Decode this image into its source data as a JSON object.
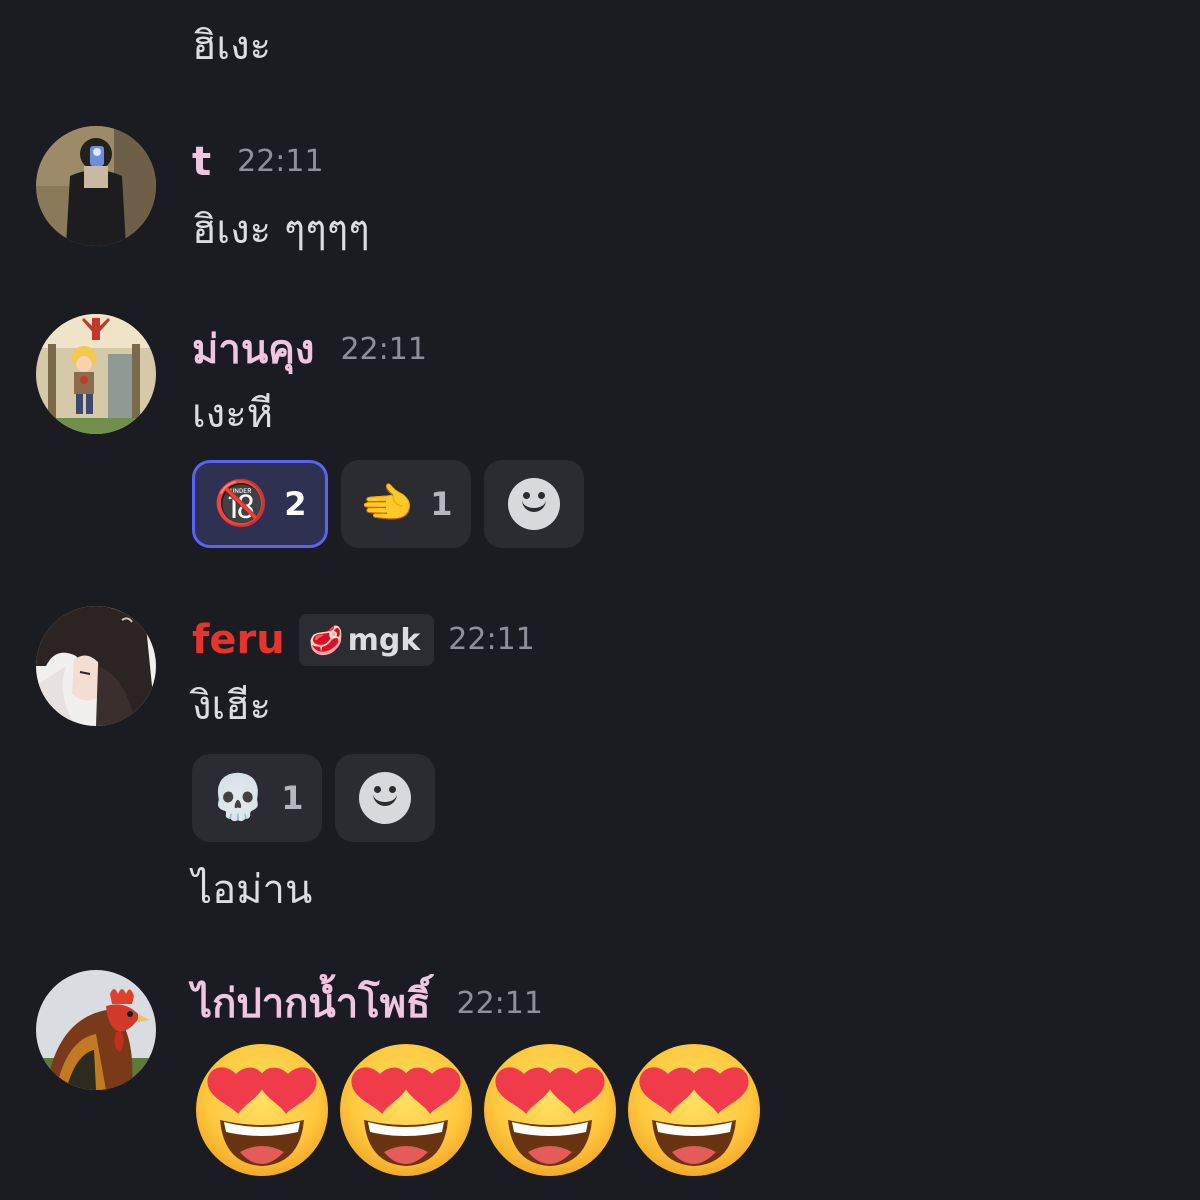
{
  "colors": {
    "background": "#1b1c21",
    "username_pink": "#f0c6dd",
    "username_red": "#e7332d",
    "timestamp": "#8e9099",
    "message_text": "#dcdde0",
    "reaction_bg": "#2b2c32",
    "reaction_active_border": "#5865f2"
  },
  "top_message": {
    "text": "ฮิเงะ"
  },
  "messages": [
    {
      "username": "t",
      "timestamp": "22:11",
      "text": "ฮิเงะ ๆๆๆๆ",
      "avatar": "user-t-avatar"
    },
    {
      "username": "ม่านคุง",
      "timestamp": "22:11",
      "text": "เงะหี",
      "avatar": "naruto-avatar",
      "reactions": [
        {
          "emoji": "🔞",
          "count": "2",
          "active": true
        },
        {
          "emoji": "🫲",
          "count": "1",
          "active": false
        }
      ]
    },
    {
      "username": "feru",
      "tag_icon": "🥩",
      "tag": "mgk",
      "timestamp": "22:11",
      "text": "งิเฮีะ",
      "avatar": "anime-avatar",
      "reactions": [
        {
          "emoji": "💀",
          "count": "1",
          "active": false
        }
      ],
      "followup_text": "ไอม่าน"
    },
    {
      "username": "ไก่ปากน้ำโพธิ์",
      "timestamp": "22:11",
      "avatar": "rooster-avatar",
      "emoji_message": [
        "😍",
        "😍",
        "😍",
        "😍"
      ]
    }
  ]
}
